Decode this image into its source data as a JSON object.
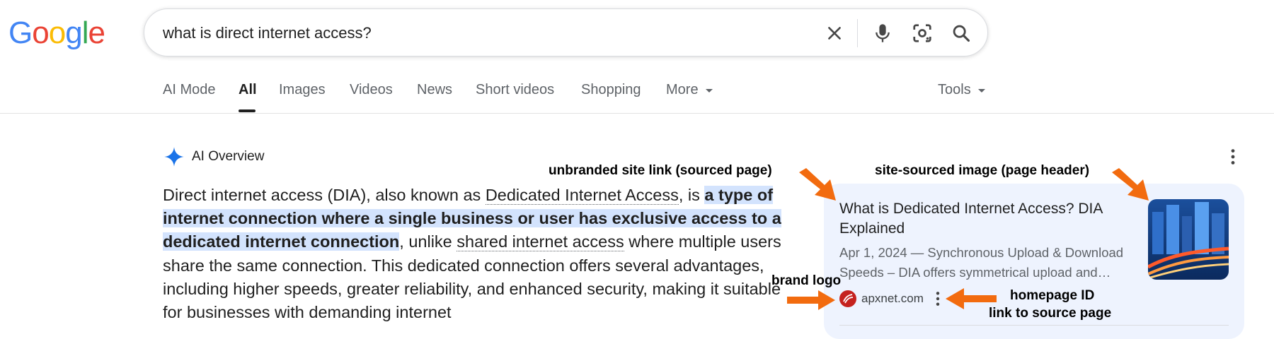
{
  "logo": {
    "letters": [
      "G",
      "o",
      "o",
      "g",
      "l",
      "e"
    ]
  },
  "search": {
    "query": "what is direct internet access?"
  },
  "tabs": [
    {
      "label": "AI Mode"
    },
    {
      "label": "All"
    },
    {
      "label": "Images"
    },
    {
      "label": "Videos"
    },
    {
      "label": "News"
    },
    {
      "label": "Short videos"
    },
    {
      "label": "Shopping"
    },
    {
      "label": "More"
    }
  ],
  "tools_label": "Tools",
  "ai_overview": {
    "title": "AI Overview",
    "p1": "Direct internet access (DIA), also known as ",
    "link1": "Dedicated Internet Access",
    "p2": ", is ",
    "highlight": "a type of internet connection where a single business or user has exclusive access to a dedicated internet connection",
    "p3": ", unlike ",
    "link2": "shared internet access",
    "p4": " where multiple users share the same connection. This dedicated connection offers several advantages, including higher speeds, greater reliability, and enhanced security, making it suitable for businesses with demanding internet"
  },
  "source_card": {
    "title": "What is Dedicated Internet Access? DIA Explained",
    "snippet": "Apr 1, 2024 — Synchronous Upload & Download Speeds – DIA offers symmetrical upload and…",
    "site": "apxnet.com"
  },
  "annotations": {
    "site_link": "unbranded site link (sourced page)",
    "site_image": "site-sourced image (page header)",
    "brand_logo": "brand logo",
    "homepage_id_1": "homepage ID",
    "homepage_id_2": "link to source page"
  },
  "colors": {
    "accent_blue": "#1a73e8",
    "highlight": "#d3e3fd",
    "card_bg": "#eef3fe",
    "arrow": "#f26b0f"
  }
}
